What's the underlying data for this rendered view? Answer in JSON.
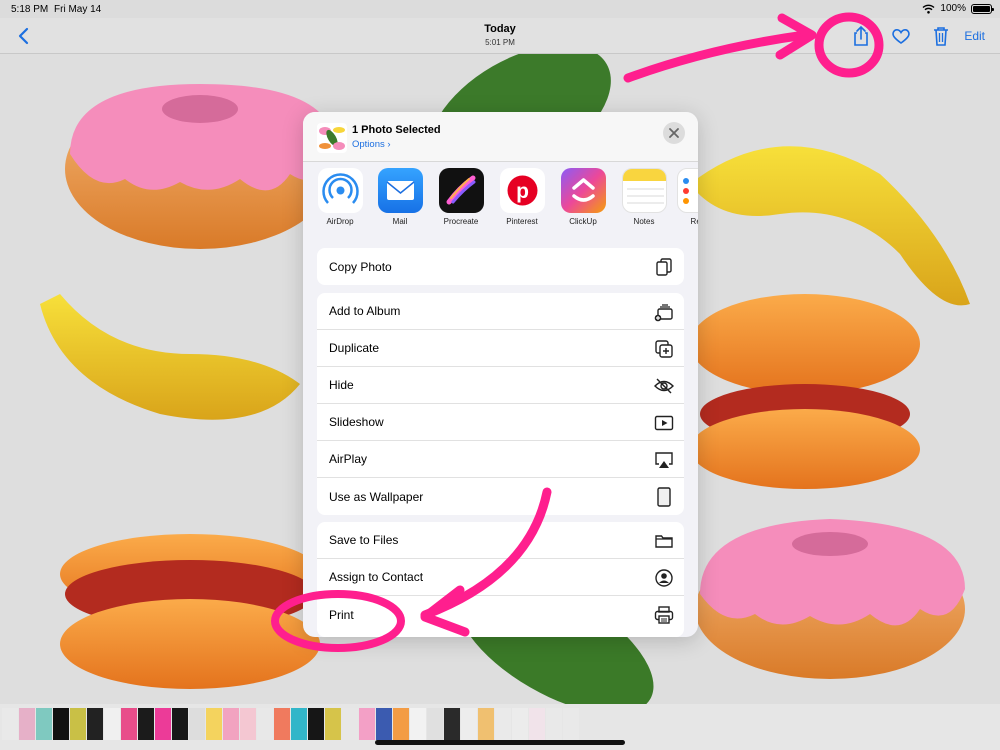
{
  "status_bar": {
    "time": "5:18 PM",
    "date": "Fri May 14",
    "battery": "100%"
  },
  "nav": {
    "title": "Today",
    "subtitle": "5:01 PM",
    "edit_label": "Edit"
  },
  "share_sheet": {
    "title": "1 Photo Selected",
    "options_label": "Options",
    "apps": [
      {
        "label": "AirDrop",
        "icon": "airdrop-icon"
      },
      {
        "label": "Mail",
        "icon": "mail-icon"
      },
      {
        "label": "Procreate",
        "icon": "procreate-icon"
      },
      {
        "label": "Pinterest",
        "icon": "pinterest-icon"
      },
      {
        "label": "ClickUp",
        "icon": "clickup-icon"
      },
      {
        "label": "Notes",
        "icon": "notes-icon"
      },
      {
        "label": "Rem",
        "icon": "reminders-icon"
      }
    ],
    "group1": [
      {
        "label": "Copy Photo",
        "icon": "copy-icon"
      }
    ],
    "group2": [
      {
        "label": "Add to Album",
        "icon": "add-album-icon"
      },
      {
        "label": "Duplicate",
        "icon": "duplicate-icon"
      },
      {
        "label": "Hide",
        "icon": "eye-slash-icon"
      },
      {
        "label": "Slideshow",
        "icon": "play-icon"
      },
      {
        "label": "AirPlay",
        "icon": "airplay-icon"
      },
      {
        "label": "Use as Wallpaper",
        "icon": "phone-icon"
      }
    ],
    "group3": [
      {
        "label": "Save to Files",
        "icon": "folder-icon"
      },
      {
        "label": "Assign to Contact",
        "icon": "contact-icon"
      },
      {
        "label": "Print",
        "icon": "printer-icon"
      }
    ]
  },
  "colors": {
    "accent": "#1c6fe0",
    "annotation": "#ff1f8e"
  }
}
